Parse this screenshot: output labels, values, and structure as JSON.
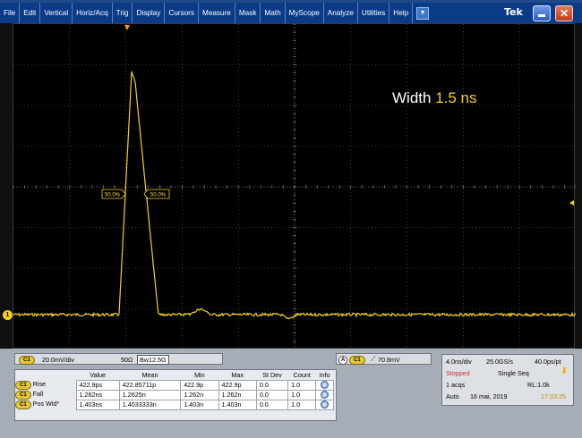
{
  "menubar": {
    "items": [
      "File",
      "Edit",
      "Vertical",
      "Horiz/Acq",
      "Trig",
      "Display",
      "Cursors",
      "Measure",
      "Mask",
      "Math",
      "MyScope",
      "Analyze",
      "Utilities",
      "Help"
    ],
    "brand": "Tek"
  },
  "screen": {
    "annotation_label": "Width",
    "annotation_value": "1.5 ns",
    "left_marker": "50.0%",
    "right_marker": "50.0%",
    "channel_marker": "1"
  },
  "channel": {
    "badge": "C1",
    "scale": "20.0mV/div",
    "impedance": "50Ω",
    "bandwidth": "12.5G"
  },
  "trigger": {
    "badge_a": "A",
    "badge_ch": "C1",
    "level": "70.8mV"
  },
  "measurements": {
    "headers": [
      "Value",
      "Mean",
      "Min",
      "Max",
      "St Dev",
      "Count",
      "Info"
    ],
    "rows": [
      {
        "badge": "C1",
        "name": "Rise",
        "value": "422.9ps",
        "mean": "422.85711p",
        "min": "422.9p",
        "max": "422.9p",
        "stdev": "0.0",
        "count": "1.0"
      },
      {
        "badge": "C1",
        "name": "Fall",
        "value": "1.262ns",
        "mean": "1.2625n",
        "min": "1.262n",
        "max": "1.262n",
        "stdev": "0.0",
        "count": "1.0"
      },
      {
        "badge": "C1",
        "name": "Pos Wid*",
        "value": "1.403ns",
        "mean": "1.4033333n",
        "min": "1.403n",
        "max": "1.403n",
        "stdev": "0.0",
        "count": "1.0"
      }
    ]
  },
  "acquisition": {
    "timebase": "4.0ns/div",
    "sample_rate": "25.0GS/s",
    "resolution": "40.0ps/pt",
    "state": "Stopped",
    "mode": "Single Seq",
    "acqs": "1 acqs",
    "record_length": "RL:1.0k",
    "trigger_mode": "Auto",
    "date": "16 mai, 2019",
    "time": "17:33:25"
  },
  "colors": {
    "trace": "#f3d21f",
    "grid": "#7a7a7a",
    "menubar": "#0b3a86",
    "stopped": "#d22d2d"
  },
  "icons": [
    "menu-dropdown-icon",
    "minimize-icon",
    "close-icon",
    "info-icon",
    "trigger-slope-icon",
    "trigger-arrow-icon",
    "bandwidth-icon"
  ]
}
